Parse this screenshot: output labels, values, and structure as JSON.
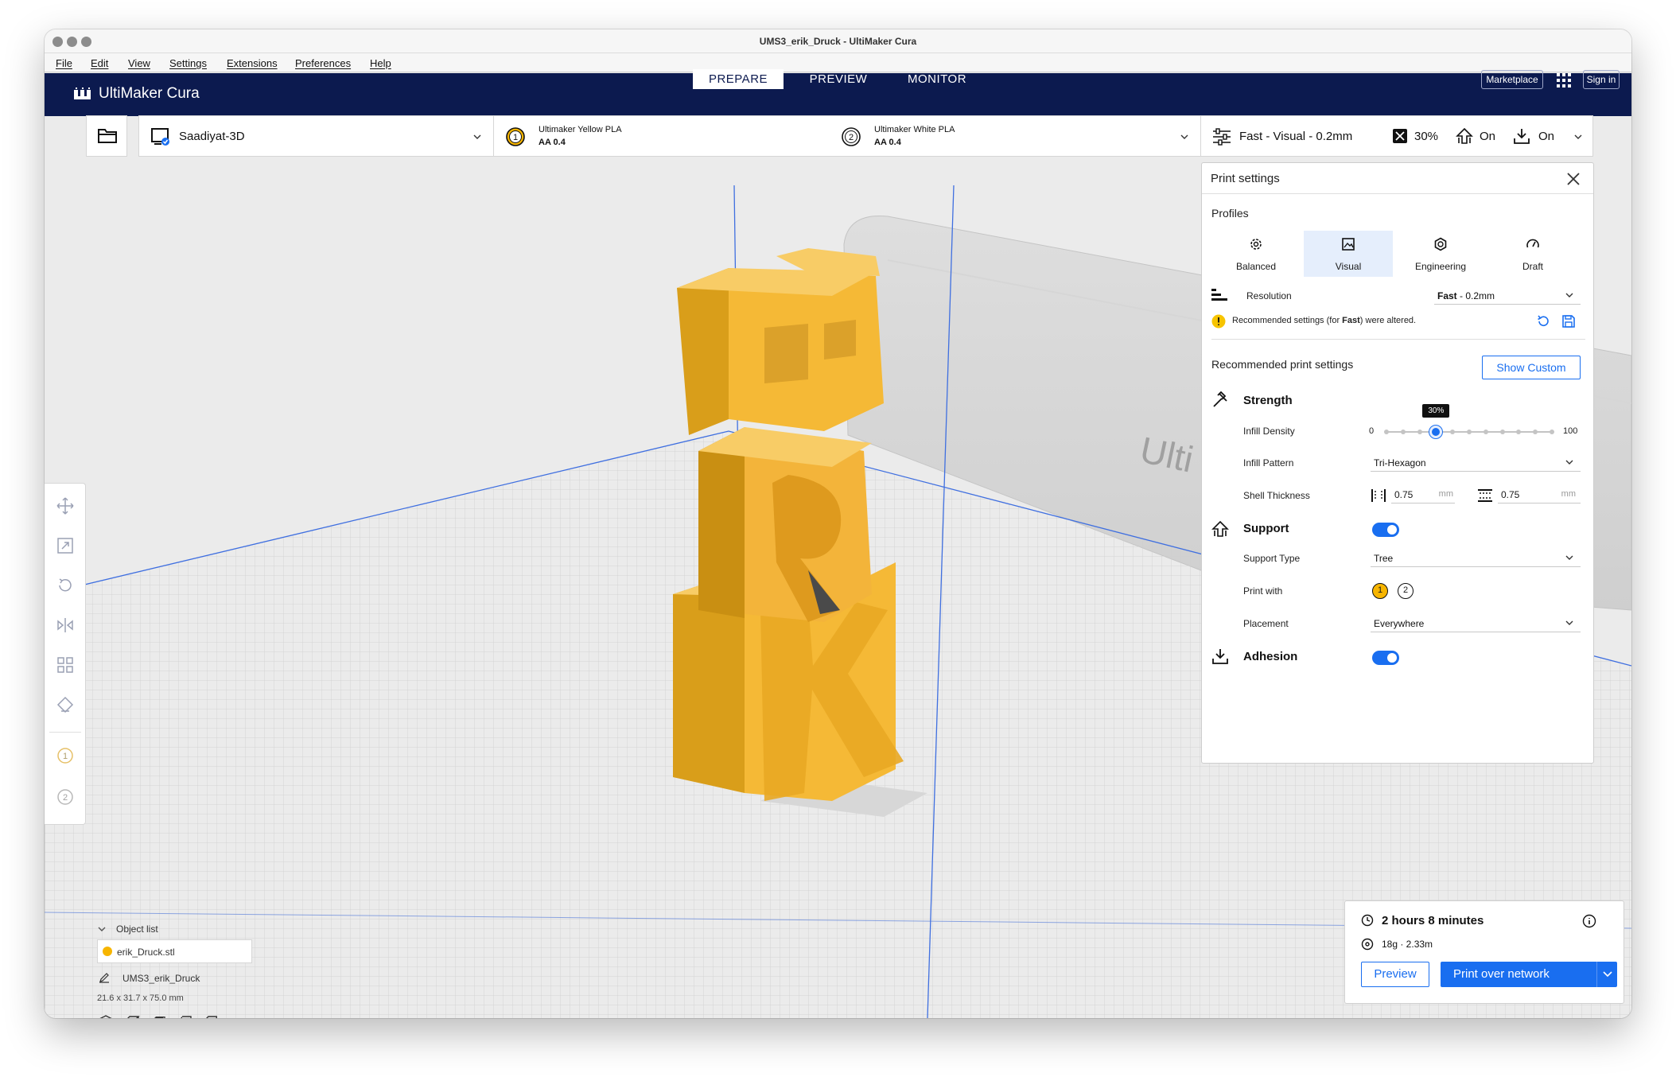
{
  "window": {
    "title": "UMS3_erik_Druck - UltiMaker Cura"
  },
  "menu": [
    "File",
    "Edit",
    "View",
    "Settings",
    "Extensions",
    "Preferences",
    "Help"
  ],
  "header": {
    "logo": "UltiMaker Cura",
    "tabs": [
      "PREPARE",
      "PREVIEW",
      "MONITOR"
    ],
    "active_tab": "PREPARE",
    "marketplace": "Marketplace",
    "sign_in": "Sign in"
  },
  "printer": {
    "name": "Saadiyat-3D"
  },
  "extruders": [
    {
      "index": "1",
      "material": "Ultimaker Yellow PLA",
      "core": "AA 0.4",
      "color": "#f7b500"
    },
    {
      "index": "2",
      "material": "Ultimaker White PLA",
      "core": "AA 0.4",
      "color": "#ffffff"
    }
  ],
  "summary": {
    "profile": "Fast - Visual - 0.2mm",
    "infill": "30%",
    "support": "On",
    "adhesion": "On"
  },
  "panel": {
    "title": "Print settings",
    "profiles_label": "Profiles",
    "profiles": [
      "Balanced",
      "Visual",
      "Engineering",
      "Draft"
    ],
    "active_profile": "Visual",
    "resolution_label": "Resolution",
    "resolution_bold": "Fast",
    "resolution_rest": " - 0.2mm",
    "warning_pre": "Recommended settings (for ",
    "warning_bold": "Fast",
    "warning_post": ") were altered.",
    "recommended_label": "Recommended print settings",
    "show_custom": "Show Custom",
    "strength": "Strength",
    "infill_density_label": "Infill Density",
    "infill_min": "0",
    "infill_max": "100",
    "infill_tooltip": "30%",
    "infill_value": 30,
    "infill_pattern_label": "Infill Pattern",
    "infill_pattern": "Tri-Hexagon",
    "shell_label": "Shell Thickness",
    "shell_wall": "0.75",
    "shell_top": "0.75",
    "unit": "mm",
    "support": "Support",
    "support_type_label": "Support Type",
    "support_type": "Tree",
    "print_with_label": "Print with",
    "print_with": [
      "1",
      "2"
    ],
    "placement_label": "Placement",
    "placement": "Everywhere",
    "adhesion": "Adhesion"
  },
  "objects": {
    "list_label": "Object list",
    "file": "erik_Druck.stl",
    "project": "UMS3_erik_Druck",
    "dimensions": "21.6 x 31.7 x 75.0 mm"
  },
  "estimate": {
    "time": "2 hours 8 minutes",
    "material": "18g · 2.33m",
    "preview": "Preview",
    "print": "Print over network"
  },
  "scene": {
    "watermark": "Ulti",
    "model_color": "#f5b936"
  }
}
